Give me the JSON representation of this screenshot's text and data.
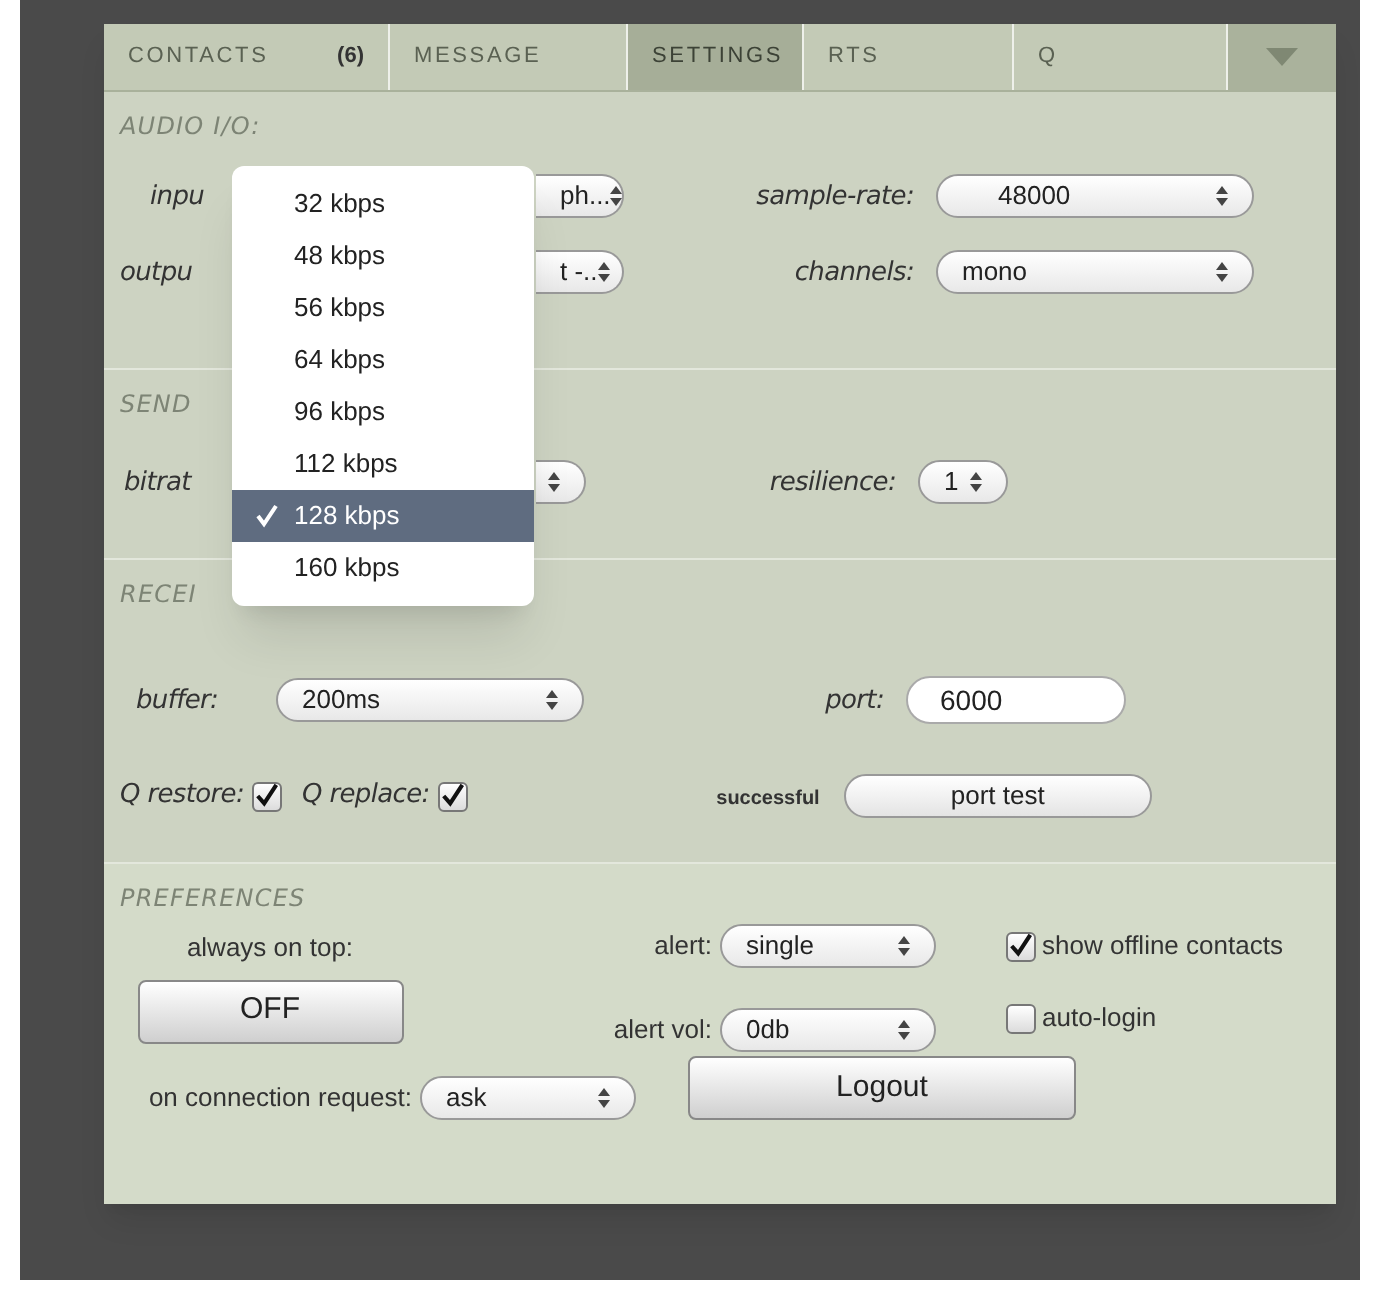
{
  "tabs": [
    {
      "label": "CONTACTS",
      "badge": "(6)",
      "selected": false
    },
    {
      "label": "MESSAGE",
      "selected": false
    },
    {
      "label": "SETTINGS",
      "selected": true
    },
    {
      "label": "RTS",
      "selected": false
    },
    {
      "label": "Q",
      "selected": false
    }
  ],
  "audio_io": {
    "title": "AUDIO I/O:",
    "input": {
      "label": "inpu",
      "value": "ph..."
    },
    "output": {
      "label": "outpu",
      "value": "t -.."
    },
    "sample_rate": {
      "label": "sample-rate:",
      "value": "48000"
    },
    "channels": {
      "label": "channels:",
      "value": "mono"
    }
  },
  "send": {
    "title": "SEND",
    "bitrate": {
      "label": "bitrat"
    },
    "resilience": {
      "label": "resilience:",
      "value": "1"
    }
  },
  "bitrate_menu": {
    "options": [
      {
        "label": "32 kbps",
        "selected": false
      },
      {
        "label": "48 kbps",
        "selected": false
      },
      {
        "label": "56 kbps",
        "selected": false
      },
      {
        "label": "64 kbps",
        "selected": false
      },
      {
        "label": "96 kbps",
        "selected": false
      },
      {
        "label": "112 kbps",
        "selected": false
      },
      {
        "label": "128 kbps",
        "selected": true
      },
      {
        "label": "160 kbps",
        "selected": false
      }
    ]
  },
  "receive": {
    "title": "RECEI",
    "buffer": {
      "label": "buffer:",
      "value": "200ms"
    },
    "port": {
      "label": "port:",
      "value": "6000"
    },
    "q_restore": {
      "label": "Q restore:",
      "checked": true
    },
    "q_replace": {
      "label": "Q replace:",
      "checked": true
    },
    "port_test": {
      "status": "successful",
      "button": "port test"
    }
  },
  "preferences": {
    "title": "PREFERENCES",
    "always_on_top": {
      "label": "always on top:",
      "button": "OFF"
    },
    "alert": {
      "label": "alert:",
      "value": "single"
    },
    "alert_vol": {
      "label": "alert vol:",
      "value": "0db"
    },
    "on_connection_request": {
      "label": "on connection request:",
      "value": "ask"
    },
    "show_offline_contacts": {
      "label": "show offline contacts",
      "checked": true
    },
    "auto_login": {
      "label": "auto-login",
      "checked": false
    },
    "logout": "Logout"
  }
}
